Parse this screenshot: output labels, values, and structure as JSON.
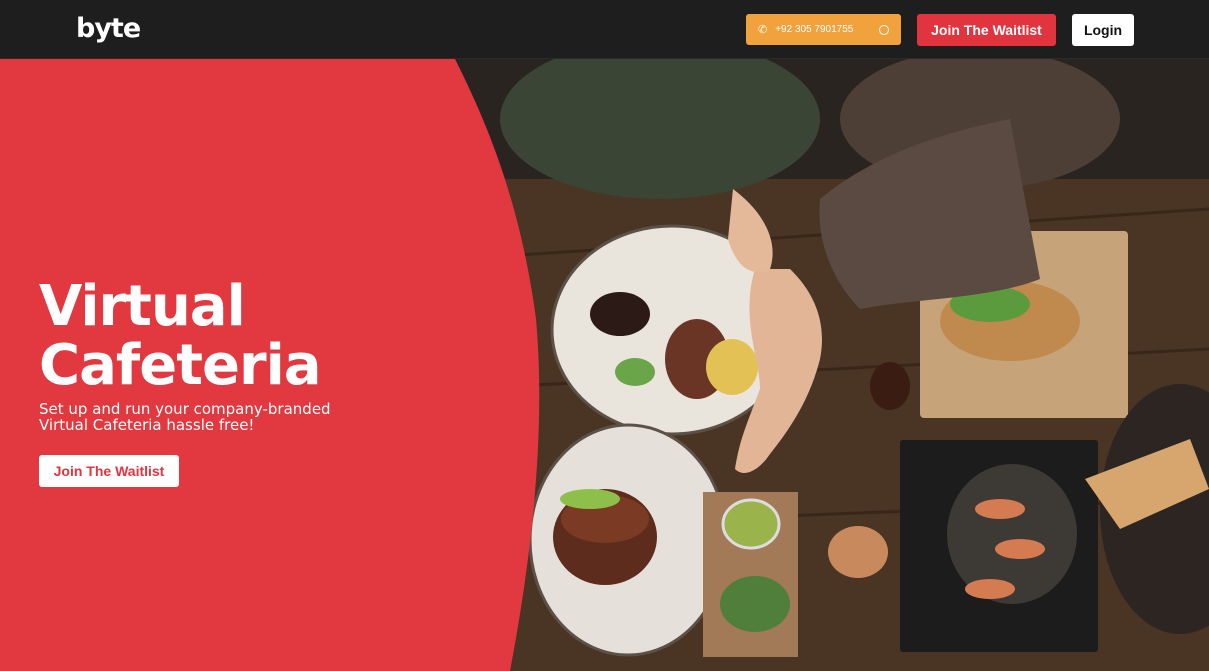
{
  "header": {
    "logo_text": "byte",
    "phone": "+92 305 7901755",
    "phone_icon": "phone-icon",
    "whatsapp_icon": "whatsapp-icon",
    "waitlist_label": "Join The Waitlist",
    "login_label": "Login"
  },
  "hero": {
    "title_line1": "Virtual",
    "title_line2": "Cafeteria",
    "subtitle_line1": "Set up and run your company-branded",
    "subtitle_line2": "Virtual Cafeteria hassle free!",
    "cta_label": "Join The Waitlist"
  },
  "colors": {
    "brand_red": "#e2343f",
    "phone_orange": "#f2a23c",
    "header_bg": "#1e1e1e"
  }
}
